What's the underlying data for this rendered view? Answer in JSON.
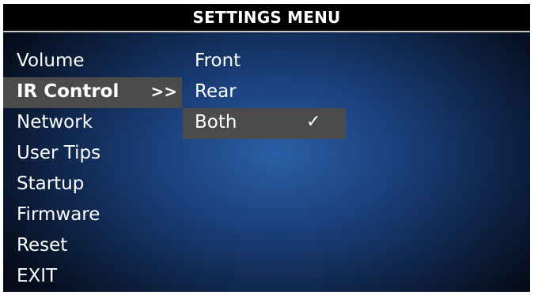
{
  "window": {
    "title": "SETTINGS MENU"
  },
  "menu": {
    "items": [
      {
        "label": "Volume"
      },
      {
        "label": "IR Control",
        "arrow": ">>"
      },
      {
        "label": "Network"
      },
      {
        "label": "User Tips"
      },
      {
        "label": "Startup"
      },
      {
        "label": "Firmware"
      },
      {
        "label": "Reset"
      },
      {
        "label": "EXIT"
      }
    ]
  },
  "submenu": {
    "items": [
      {
        "label": "Front"
      },
      {
        "label": "Rear"
      },
      {
        "label": "Both",
        "check": "✓"
      }
    ]
  },
  "colors": {
    "title_background": "#000000",
    "selected_highlight": "#4b4b4b",
    "background_center": "#2b5fa6",
    "background_edge": "#050b18",
    "text": "#ffffff"
  },
  "icons": {
    "submenu_arrow": "double-chevron-right-icon",
    "selected_check": "check-icon"
  }
}
